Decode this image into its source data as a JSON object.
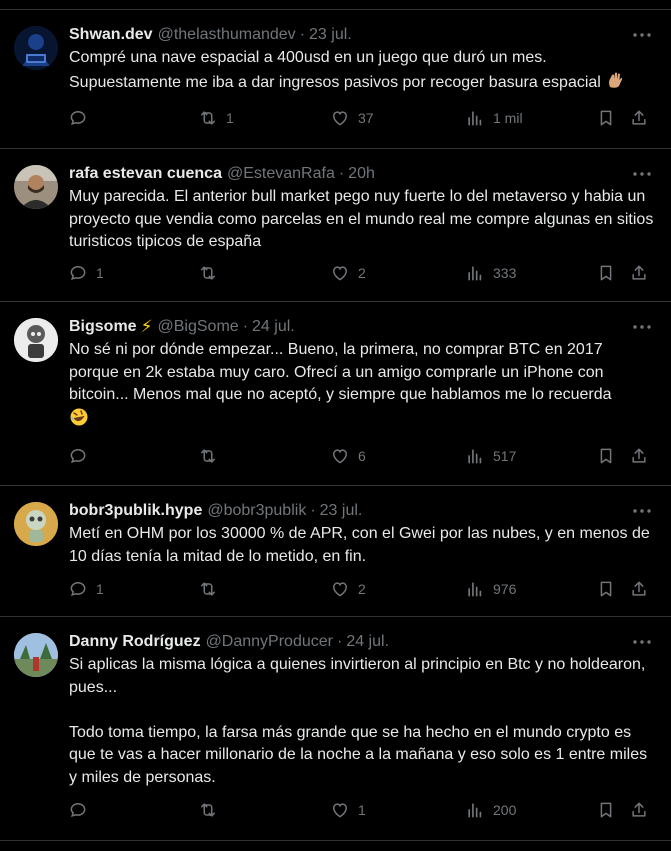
{
  "tweets": [
    {
      "name": "Shwan.dev",
      "handle": "@thelasthumandev",
      "sep": "·",
      "time": "23 jul.",
      "text": "Compré una nave espacial a 400usd en un juego que duró un mes. Supuestamente me iba a dar ingresos pasivos por recoger basura espacial",
      "emoji": "waving-hand",
      "replies": "",
      "retweets": "1",
      "likes": "37",
      "views": "1 mil"
    },
    {
      "name": "rafa estevan cuenca",
      "handle": "@EstevanRafa",
      "sep": "·",
      "time": "20h",
      "text": "Muy parecida. El anterior bull market pego nuy fuerte lo del metaverso y habia un proyecto que vendia como parcelas en el mundo real me compre algunas en sitios turisticos tipicos de españa",
      "replies": "1",
      "retweets": "",
      "likes": "2",
      "views": "333"
    },
    {
      "name": "Bigsome",
      "badge": "⚡",
      "handle": "@BigSome",
      "sep": "·",
      "time": "24 jul.",
      "text": "No sé ni por dónde empezar... Bueno, la primera, no comprar BTC en 2017 porque en 2k estaba muy caro. Ofrecí a un amigo comprarle un iPhone con bitcoin... Menos mal que no aceptó, y siempre que hablamos me lo recuerda",
      "emoji": "rolling-laughing",
      "replies": "",
      "retweets": "",
      "likes": "6",
      "views": "517"
    },
    {
      "name": "bobr3publik.hype",
      "handle": "@bobr3publik",
      "sep": "·",
      "time": "23 jul.",
      "text": "Metí en OHM por los 30000 % de APR, con el Gwei por las nubes, y en menos de 10 días tenía la mitad de lo metido, en fin.",
      "replies": "1",
      "retweets": "",
      "likes": "2",
      "views": "976"
    },
    {
      "name": "Danny Rodríguez",
      "handle": "@DannyProducer",
      "sep": "·",
      "time": "24 jul.",
      "text": "Si aplicas la misma lógica a quienes invirtieron al principio en Btc y no holdearon, pues...\n\nTodo toma tiempo, la farsa más grande que se ha hecho en el mundo crypto es que te vas a hacer millonario de la noche a la mañana y eso solo es 1 entre miles y miles de personas.",
      "replies": "",
      "retweets": "",
      "likes": "1",
      "views": "200"
    }
  ],
  "colors": {
    "background": "#000000",
    "text": "#e7e9ea",
    "muted": "#71767b",
    "border": "#2f3336"
  }
}
